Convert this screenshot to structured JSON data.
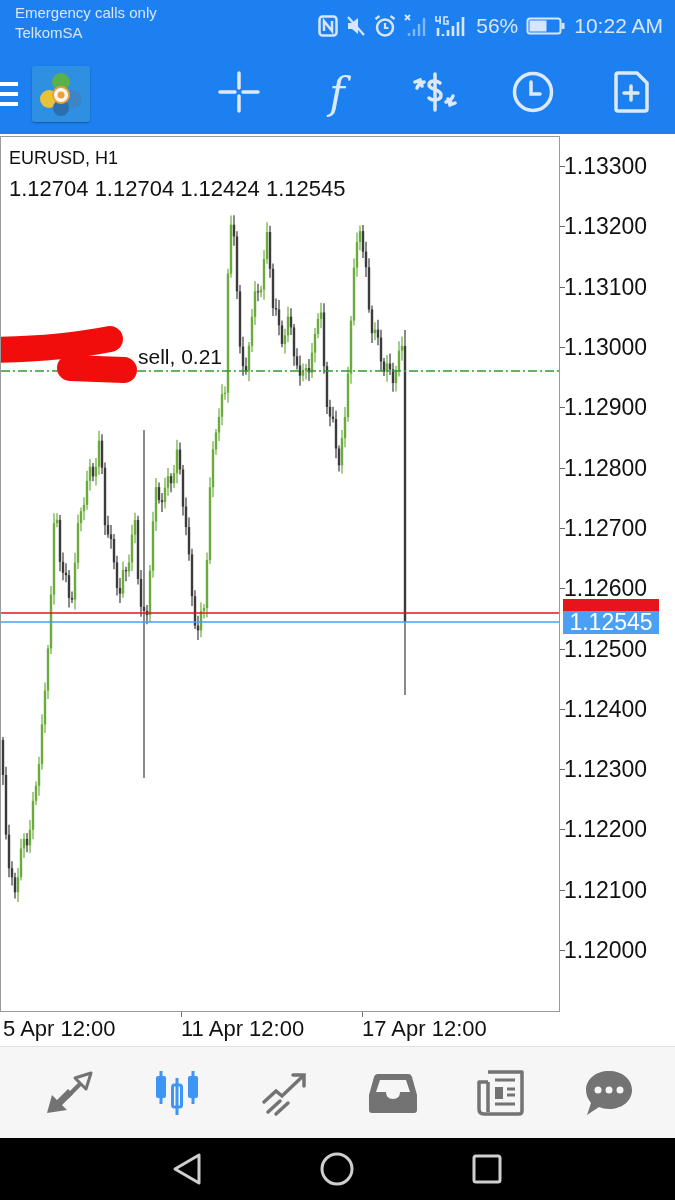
{
  "status_bar": {
    "carrier_lines": [
      "Emergency calls only",
      "TelkomSA"
    ],
    "battery": "56%",
    "time": "10:22 AM"
  },
  "toolbar": {
    "items": [
      {
        "kind": "crosshair"
      },
      {
        "kind": "indicators",
        "glyph": "f"
      },
      {
        "kind": "trade"
      },
      {
        "kind": "timeframe"
      },
      {
        "kind": "new-order"
      }
    ]
  },
  "chart": {
    "symbol": "EURUSD, H1",
    "ohlc": "1.12704 1.12704 1.12424 1.12545",
    "order_label": "sell, 0.21",
    "bid_tag": "1.12545",
    "price_axis": [
      "1.13300",
      "1.13200",
      "1.13100",
      "1.13000",
      "1.12900",
      "1.12800",
      "1.12700",
      "1.12600",
      "1.12500",
      "1.12400",
      "1.12300",
      "1.12200",
      "1.12100",
      "1.12000"
    ],
    "time_axis": [
      "5 Apr 12:00",
      "11 Apr 12:00",
      "17 Apr 12:00"
    ]
  },
  "bottom_nav": [
    {
      "kind": "quotes",
      "selected": false
    },
    {
      "kind": "chart",
      "selected": true
    },
    {
      "kind": "trade",
      "selected": false
    },
    {
      "kind": "history",
      "selected": false
    },
    {
      "kind": "news",
      "selected": false
    },
    {
      "kind": "chat",
      "selected": false
    }
  ]
}
